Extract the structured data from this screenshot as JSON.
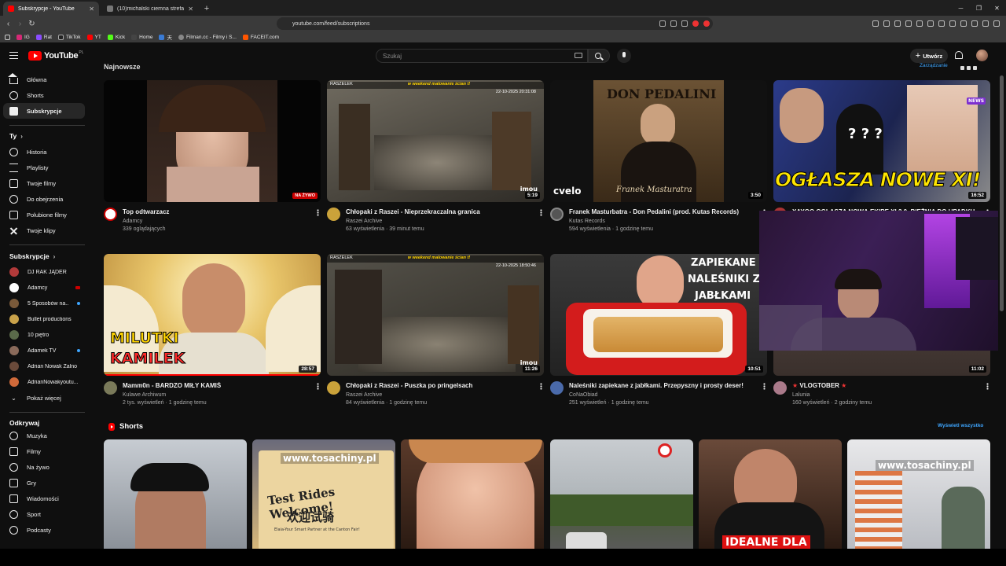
{
  "browser": {
    "tabs": [
      {
        "label": "Subskrypcje - YouTube",
        "active": true,
        "color": "#ff0000"
      },
      {
        "label": "(10)michalski ciemna strefa (@micha...",
        "active": false,
        "color": "#777777"
      }
    ],
    "new_tab": "+",
    "address": "youtube.com/feed/subscriptions",
    "bookmarks": [
      {
        "label": "IG",
        "color": "#d62976"
      },
      {
        "label": "Rat",
        "color": "#8a4dff"
      },
      {
        "label": "TikTok",
        "color": "#222222"
      },
      {
        "label": "YT",
        "color": "#ff0000"
      },
      {
        "label": "Kick",
        "color": "#53fc18"
      },
      {
        "label": "Home",
        "color": "#444444"
      },
      {
        "label": "天",
        "color": "#3a7bd5"
      },
      {
        "label": "Filman.cc - Filmy i S...",
        "color": "#888888"
      },
      {
        "label": "FACEIT.com",
        "color": "#ff5500"
      }
    ]
  },
  "yt": {
    "logo": "YouTube",
    "country": "PL",
    "search_placeholder": "Szukaj",
    "create_label": "Utwórz",
    "create_icon": "+"
  },
  "sidebar": {
    "main": [
      "Główna",
      "Shorts",
      "Subskrypcje"
    ],
    "you_heading": "Ty",
    "you_items": [
      "Historia",
      "Playlisty",
      "Twoje filmy",
      "Do obejrzenia",
      "Polubione filmy",
      "Twoje klipy"
    ],
    "subs_heading": "Subskrypcje",
    "subs": [
      {
        "name": "DJ RAK JĄDER",
        "color": "#b23a3a",
        "badge": "none"
      },
      {
        "name": "Adamcy",
        "color": "#ffffff",
        "badge": "live"
      },
      {
        "name": "5 Sposobów na...",
        "color": "#7a5a3a",
        "badge": "dot"
      },
      {
        "name": "Bullet productions",
        "color": "#c9a24a",
        "badge": "none"
      },
      {
        "name": "10 piętro",
        "color": "#5a6a4a",
        "badge": "none"
      },
      {
        "name": "Adamek TV",
        "color": "#8a6a5a",
        "badge": "dot"
      },
      {
        "name": "Adrian Nowak Żalno",
        "color": "#6a4a3a",
        "badge": "none"
      },
      {
        "name": "AdrianNowakyoutu...",
        "color": "#d06a3a",
        "badge": "none"
      }
    ],
    "show_more": "Pokaż więcej",
    "explore_heading": "Odkrywaj",
    "explore_items": [
      "Muzyka",
      "Filmy",
      "Na żywo",
      "Gry",
      "Wiadomości",
      "Sport",
      "Podcasty"
    ]
  },
  "feed": {
    "section_title": "Najnowsze",
    "manage_label": "Zarządzanie",
    "videos": [
      {
        "title": "Top odtwarzacz",
        "channel": "Adamcy",
        "meta": "339 oglądających",
        "duration": "",
        "live_label": "NA ŻYWO",
        "avatar": "#ffffff"
      },
      {
        "title": "Chłopaki z Raszei - Nieprzekraczalna granica",
        "channel": "Raszei Archive",
        "meta": "63 wyświetlenia · 39 minut temu",
        "duration": "5:19",
        "avatar": "#caa23a"
      },
      {
        "title": "Franek Masturbatra - Don Pedalini (prod. Kutas Records)",
        "channel": "Kutas Records",
        "meta": "594 wyświetlenia · 1 godzinę temu",
        "duration": "3:50",
        "avatar": "#555555"
      },
      {
        "title": "XAYOO OGŁASZA NOWĄ EKIPĘ XI 3.0. BIEŻNIA DO UPADKU",
        "channel": "",
        "meta": "",
        "duration": "16:52",
        "avatar": "#aa3333"
      },
      {
        "title": "Mamm0n - BARDZO MIŁY KAMIŚ",
        "channel": "Kulawe Archiwum",
        "meta": "2 tys. wyświetleń · 1 godzinę temu",
        "duration": "28:57",
        "avatar": "#7a7a5a"
      },
      {
        "title": "Chłopaki z Raszei - Puszka po pringelsach",
        "channel": "Raszei Archive",
        "meta": "84 wyświetlenia · 1 godzinę temu",
        "duration": "11:26",
        "avatar": "#caa23a"
      },
      {
        "title": "Naleśniki zapiekane z jabłkami. Przepyszny i prosty deser!",
        "channel": "CoNaObiad",
        "meta": "251 wyświetleń · 1 godzinę temu",
        "duration": "10:51",
        "avatar": "#4a6aaa"
      },
      {
        "title": "VLOGTOBER",
        "channel": "Lalunia",
        "meta": "160 wyświetleń · 2 godziny temu",
        "duration": "11:02",
        "avatar": "#aa7a8a"
      }
    ],
    "thumb_texts": {
      "raszei_banner": "RASZELEK",
      "raszei_promo": "w weekend malowanie ścian t!",
      "raszei_time_1": "22-10-2025 20:31:08",
      "raszei_time_2": "22-10-2025 18:50:46",
      "raszei_wm": "imou",
      "don_title": "DON PEDALINI",
      "don_sub": "Franek Masturatra",
      "cvelo": "cvelo",
      "xayoo_text": "OGŁASZA NOWE XI!",
      "xayoo_news": "NEWS",
      "milutki_1": "MILUTKI",
      "milutki_2": "KAMILEK",
      "zapiekane_1": "ZAPIEKANE",
      "zapiekane_2": "NALEŚNIKI Z",
      "zapiekane_3": "JABŁKAMI"
    }
  },
  "shorts": {
    "title": "Shorts",
    "see_all": "Wyświetl wszystko",
    "texts": {
      "site": "www.tosachiny.pl",
      "sign_1": "Test Rides Welcome!",
      "sign_2": "欢迎试骑",
      "sign_3": "Elaia-Your Smart Partner at the Canton Fair!",
      "idealne": "IDEALNE DLA"
    }
  },
  "colors": {
    "bg": "#0f0f0f",
    "accent": "#ff0000",
    "link": "#3ea6ff"
  }
}
